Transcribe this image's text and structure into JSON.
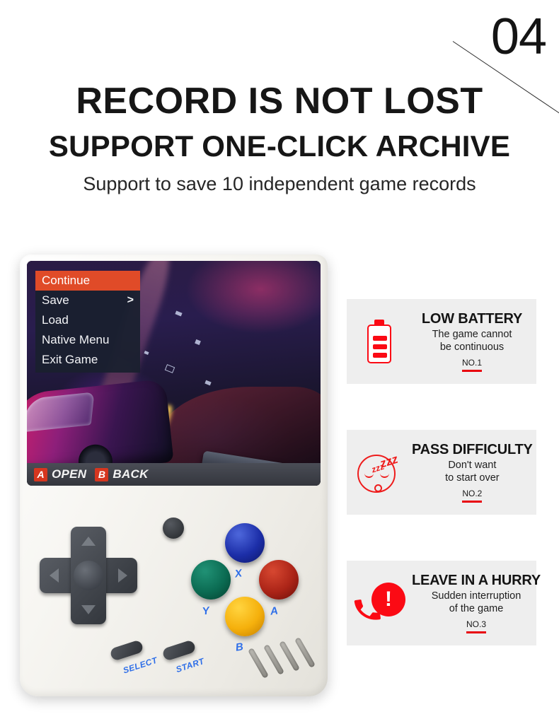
{
  "header": {
    "section_number": "04",
    "headline_1": "RECORD IS NOT LOST",
    "headline_2": "SUPPORT ONE-CLICK ARCHIVE",
    "subheadline": "Support to save 10 independent game records"
  },
  "console": {
    "game_menu": {
      "items": [
        {
          "label": "Continue",
          "arrow": "",
          "selected": true
        },
        {
          "label": "Save",
          "arrow": ">",
          "selected": false
        },
        {
          "label": "Load",
          "arrow": "",
          "selected": false
        },
        {
          "label": "Native Menu",
          "arrow": "",
          "selected": false
        },
        {
          "label": "Exit Game",
          "arrow": "",
          "selected": false
        }
      ]
    },
    "hint_bar": {
      "open_badge": "A",
      "open_label": "OPEN",
      "back_badge": "B",
      "back_label": "BACK"
    },
    "buttons": {
      "x": "X",
      "y": "Y",
      "a": "A",
      "b": "B",
      "select": "SELECT",
      "start": "START"
    }
  },
  "cards": [
    {
      "icon": "low-battery-icon",
      "title": "LOW BATTERY",
      "desc_line1": "The game cannot",
      "desc_line2": "be continuous",
      "number": "NO.1"
    },
    {
      "icon": "sleepy-face-icon",
      "title": "PASS DIFFICULTY",
      "desc_line1": "Don't want",
      "desc_line2": "to start over",
      "number": "NO.2",
      "zzz": "zzz"
    },
    {
      "icon": "phone-alert-icon",
      "title": "LEAVE IN A HURRY",
      "desc_line1": "Sudden interruption",
      "desc_line2": "of the game",
      "number": "NO.3",
      "alert_mark": "!"
    }
  ],
  "colors": {
    "accent_red": "#e8000d",
    "icon_red": "#fb0a14",
    "menu_highlight": "#e04b28",
    "label_blue": "#2f6fe8",
    "card_bg": "#eeeeee"
  }
}
